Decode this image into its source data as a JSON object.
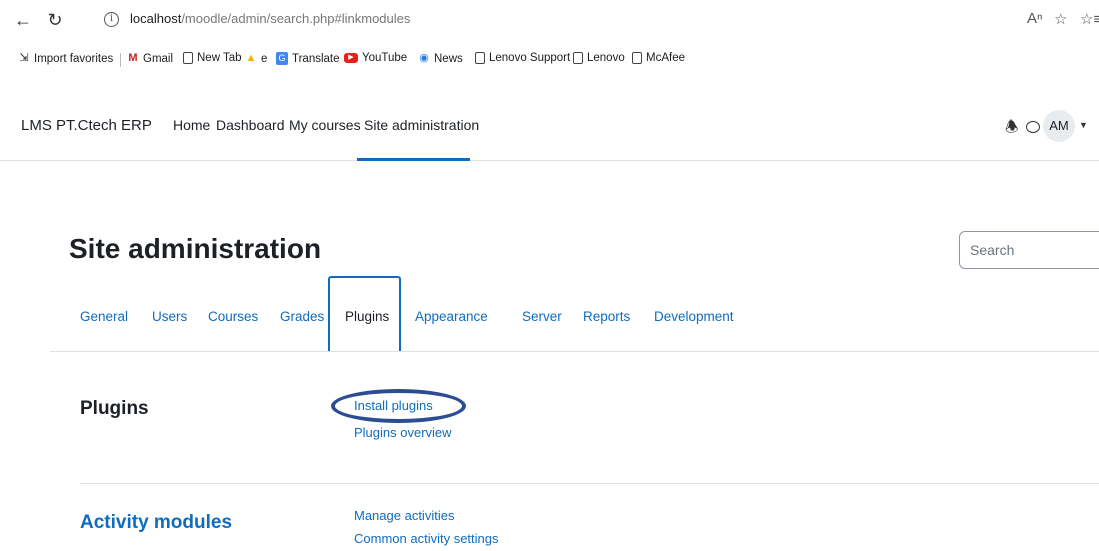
{
  "browser": {
    "url_host": "localhost",
    "url_path": "/moodle/admin/search.php#linkmodules",
    "bookmarks": [
      {
        "label": "Import favorites",
        "icon": "import-icon"
      },
      {
        "label": "Gmail",
        "icon": "gmail-icon"
      },
      {
        "label": "New Tab",
        "icon": "page-icon"
      },
      {
        "label": "e",
        "icon": "drive-icon"
      },
      {
        "label": "Translate",
        "icon": "translate-icon"
      },
      {
        "label": "YouTube",
        "icon": "youtube-icon"
      },
      {
        "label": "News",
        "icon": "news-icon"
      },
      {
        "label": "Lenovo Support",
        "icon": "page-icon"
      },
      {
        "label": "Lenovo",
        "icon": "page-icon"
      },
      {
        "label": "McAfee",
        "icon": "page-icon"
      }
    ]
  },
  "navbar": {
    "brand": "LMS PT.Ctech ERP",
    "links": [
      "Home",
      "Dashboard",
      "My courses",
      "Site administration"
    ],
    "active": "Site administration",
    "avatar_initials": "AM"
  },
  "page": {
    "title": "Site administration",
    "search_placeholder": "Search"
  },
  "tabs": [
    "General",
    "Users",
    "Courses",
    "Grades",
    "Plugins",
    "Appearance",
    "Server",
    "Reports",
    "Development"
  ],
  "active_tab": "Plugins",
  "sections": [
    {
      "heading": "Plugins",
      "links": [
        "Install plugins",
        "Plugins overview"
      ],
      "highlighted_link": "Install plugins"
    },
    {
      "heading": "Activity modules",
      "links": [
        "Manage activities",
        "Common activity settings"
      ]
    }
  ],
  "colors": {
    "link": "#0f6cbf",
    "highlight": "#2b4d91",
    "text": "#1d2125"
  }
}
